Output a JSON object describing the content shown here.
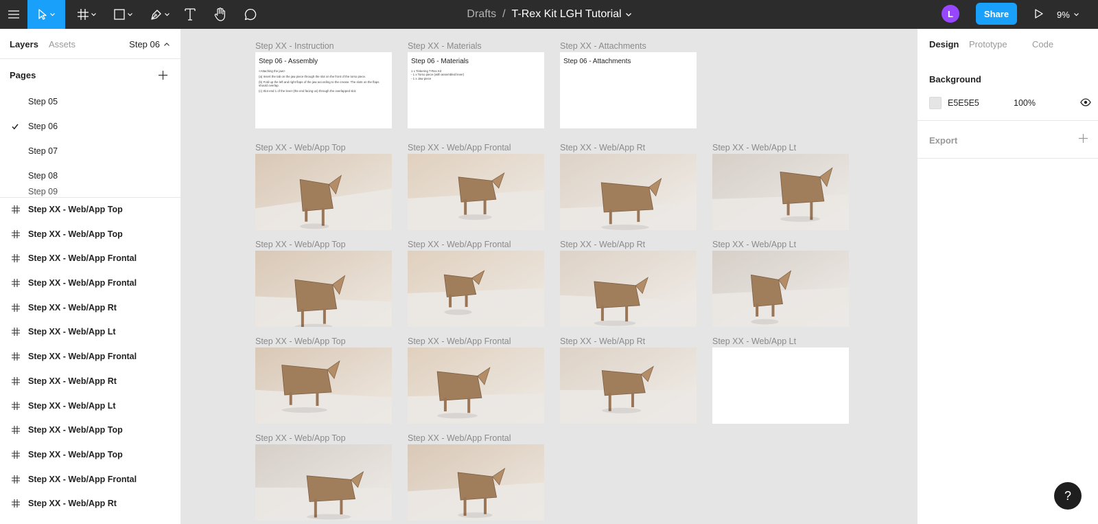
{
  "toolbar": {
    "breadcrumb": "Drafts",
    "separator": "/",
    "file_name": "T-Rex Kit LGH Tutorial",
    "avatar_initial": "L",
    "share_label": "Share",
    "zoom": "9%"
  },
  "left_panel": {
    "tabs": {
      "layers": "Layers",
      "assets": "Assets"
    },
    "current_page": "Step 06",
    "pages_title": "Pages",
    "pages": [
      {
        "label": "Step 05",
        "selected": false
      },
      {
        "label": "Step 06",
        "selected": true
      },
      {
        "label": "Step 07",
        "selected": false
      },
      {
        "label": "Step 08",
        "selected": false
      },
      {
        "label": "Step 09",
        "selected": false
      }
    ],
    "layers": [
      "Step XX - Web/App Top",
      "Step XX - Web/App Top",
      "Step XX - Web/App Frontal",
      "Step XX - Web/App Frontal",
      "Step XX - Web/App Rt",
      "Step XX - Web/App Lt",
      "Step XX - Web/App Frontal",
      "Step XX - Web/App Rt",
      "Step XX - Web/App Lt",
      "Step XX - Web/App Top",
      "Step XX - Web/App Top",
      "Step XX - Web/App Frontal",
      "Step XX - Web/App Rt"
    ]
  },
  "canvas": {
    "text_frames": [
      {
        "label": "Step XX - Instruction",
        "title": "Step 06 - Assembly",
        "lines": [
          "<Attaching the jaw>",
          "(a) Insert the tab on the jaw piece through the slot on the front of the torso piece.",
          "(b) Fold up the left and right flaps of the jaw according to the crease. The slots on the flaps should overlap.",
          "(c) Slot end 1 of the lever (the end facing us) through the overlapped slot."
        ]
      },
      {
        "label": "Step XX - Materials",
        "title": "Step 06 - Materials",
        "lines": [
          "1 x Tinkering T-Rex Kit",
          "- 1 x Torso piece (with assembled lever)",
          "- 1 x Jaw piece"
        ]
      },
      {
        "label": "Step XX - Attachments",
        "title": "Step 06 - Attachments",
        "lines": []
      }
    ],
    "photo_frames": [
      {
        "label": "Step XX - Web/App Top",
        "variant": 0
      },
      {
        "label": "Step XX - Web/App Frontal",
        "variant": 1
      },
      {
        "label": "Step XX - Web/App Rt",
        "variant": 2
      },
      {
        "label": "Step XX - Web/App Lt",
        "variant": 3
      },
      {
        "label": "Step XX - Web/App Top",
        "variant": 4
      },
      {
        "label": "Step XX - Web/App Frontal",
        "variant": 5
      },
      {
        "label": "Step XX - Web/App Rt",
        "variant": 6
      },
      {
        "label": "Step XX - Web/App Lt",
        "variant": 7
      },
      {
        "label": "Step XX - Web/App Top",
        "variant": 8
      },
      {
        "label": "Step XX - Web/App Frontal",
        "variant": 9
      },
      {
        "label": "Step XX - Web/App Rt",
        "variant": 10
      },
      {
        "label": "Step XX - Web/App Lt",
        "variant": -1
      },
      {
        "label": "Step XX - Web/App Top",
        "variant": 11
      },
      {
        "label": "Step XX - Web/App Frontal",
        "variant": 12
      }
    ]
  },
  "right_panel": {
    "tabs": {
      "design": "Design",
      "prototype": "Prototype",
      "code": "Code"
    },
    "background_title": "Background",
    "background_hex": "E5E5E5",
    "background_opacity": "100%",
    "export_title": "Export"
  },
  "help_label": "?"
}
